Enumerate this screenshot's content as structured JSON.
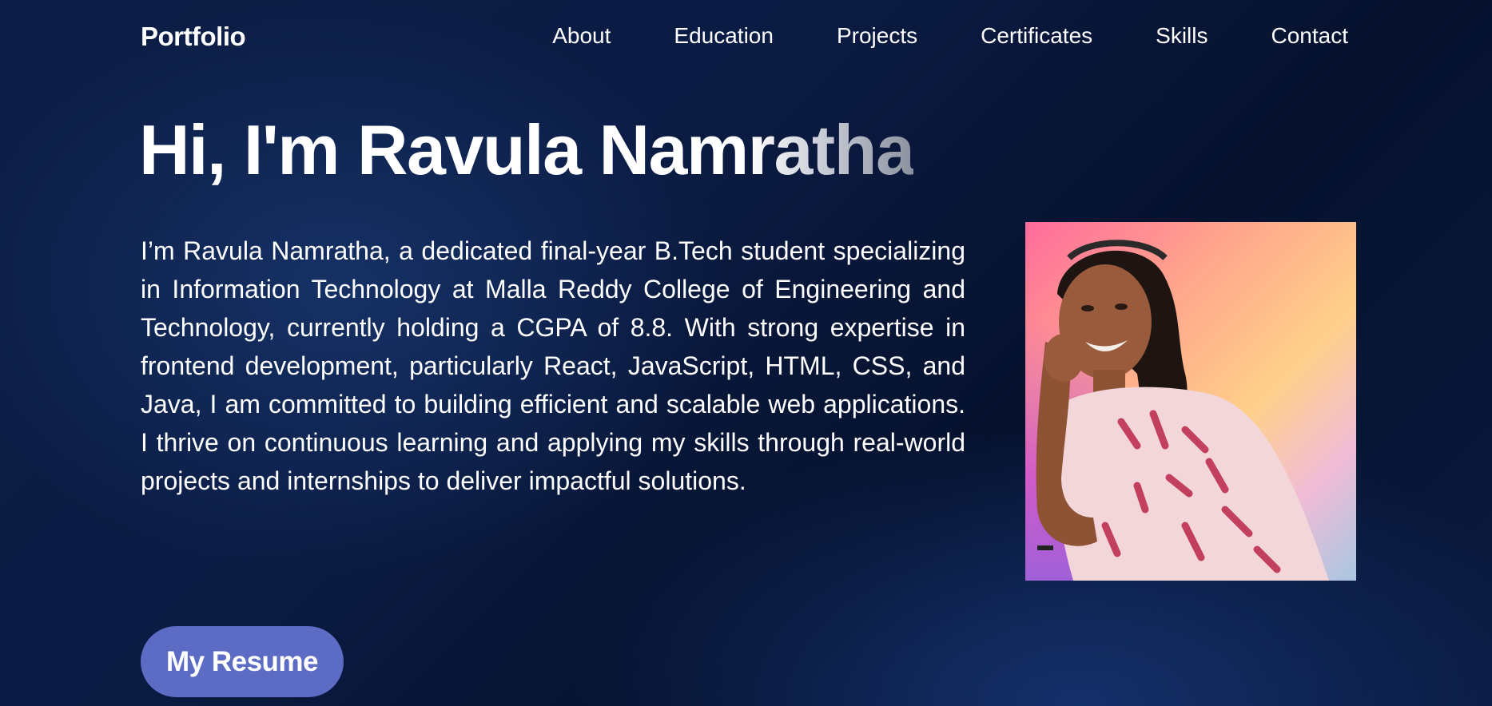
{
  "header": {
    "brand": "Portfolio",
    "nav": [
      {
        "label": "About"
      },
      {
        "label": "Education"
      },
      {
        "label": "Projects"
      },
      {
        "label": "Certificates"
      },
      {
        "label": "Skills"
      },
      {
        "label": "Contact"
      }
    ]
  },
  "hero": {
    "greeting_solid": "Hi, I'm Ravula Nam",
    "greeting_fade": "ratha",
    "description": "I’m Ravula Namratha, a dedicated final-year B.Tech student specializing in Information Technology at Malla Reddy College of Engineering and Technology, currently holding a CGPA of 8.8. With strong expertise in frontend development, particularly React, JavaScript, HTML, CSS, and Java, I am committed to building efficient and scalable web applications. I thrive on continuous learning and applying my skills through real-world projects and internships to deliver impactful solutions.",
    "resume_label": "My Resume"
  },
  "colors": {
    "background": "#0b1c44",
    "button": "#5c6cc4",
    "text": "#ffffff"
  }
}
